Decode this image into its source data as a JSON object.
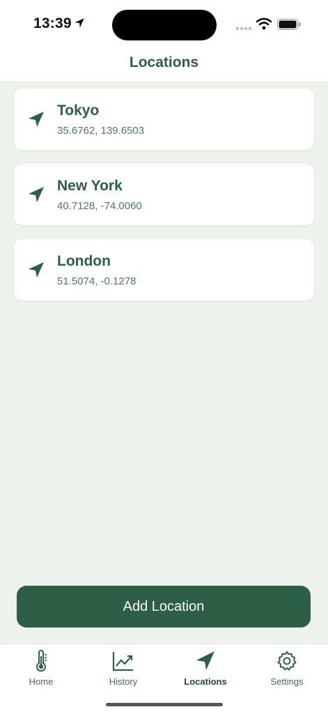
{
  "status_bar": {
    "time": "13:39"
  },
  "header": {
    "title": "Locations"
  },
  "locations": [
    {
      "name": "Tokyo",
      "coords": "35.6762, 139.6503"
    },
    {
      "name": "New York",
      "coords": "40.7128, -74.0060"
    },
    {
      "name": "London",
      "coords": "51.5074, -0.1278"
    }
  ],
  "add_button": {
    "label": "Add Location"
  },
  "tabs": [
    {
      "label": "Home",
      "icon": "thermometer-icon"
    },
    {
      "label": "History",
      "icon": "chart-trend-icon"
    },
    {
      "label": "Locations",
      "icon": "location-arrow-icon",
      "active": true
    },
    {
      "label": "Settings",
      "icon": "gear-icon"
    }
  ],
  "colors": {
    "accent": "#2c5f46",
    "background": "#edf3ec",
    "card": "#ffffff"
  }
}
